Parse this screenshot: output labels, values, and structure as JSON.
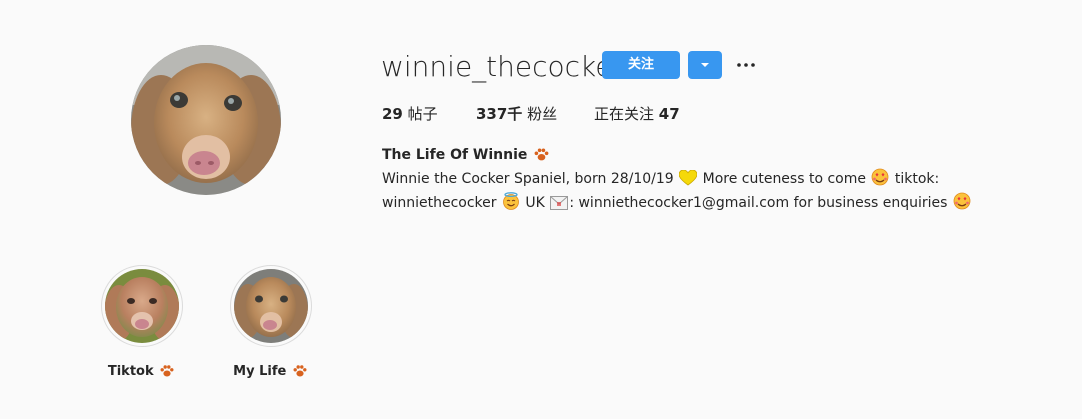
{
  "profile": {
    "username": "winnie_thecocker",
    "follow_label": "关注",
    "stats": {
      "posts_count": "29",
      "posts_label": "帖子",
      "followers_count": "337千",
      "followers_label": "粉丝",
      "following_label": "正在关注",
      "following_count": "47"
    },
    "bio": {
      "name": "The Life Of Winnie",
      "line1_a": "Winnie the Cocker Spaniel, born 28/10/19",
      "line1_b": "More cuteness to come",
      "line1_c": "tiktok:",
      "line2_a": "winniethecocker",
      "line2_b": "UK",
      "line2_c": ": winniethecocker1@gmail.com for business enquiries"
    }
  },
  "highlights": [
    {
      "label": "Tiktok"
    },
    {
      "label": "My Life"
    }
  ],
  "icons": {
    "paw": "paw-icon",
    "heart": "yellow-heart-icon",
    "hearts_face": "smiling-face-with-hearts-icon",
    "halo_face": "smiling-face-with-halo-icon",
    "envelope": "envelope-icon"
  },
  "colors": {
    "accent": "#3897f0",
    "text": "#262626",
    "background": "#fafafa"
  }
}
